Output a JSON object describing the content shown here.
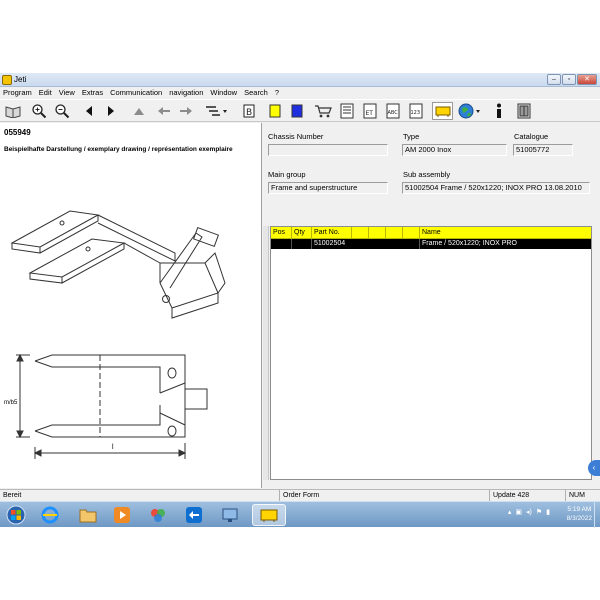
{
  "window": {
    "title": "Jeti"
  },
  "menu": [
    "Program",
    "Edit",
    "View",
    "Extras",
    "Communication",
    "navigation",
    "Window",
    "Search",
    "?"
  ],
  "left": {
    "part_number": "055949",
    "caption": "Beispielhafte Darstellung / exemplary drawing / représentation exemplaire",
    "dim_height": "m/b5",
    "dim_length": "l"
  },
  "fields": {
    "chassis_label": "Chassis Number",
    "chassis_value": "",
    "type_label": "Type",
    "type_value": "AM 2000 Inox",
    "catalogue_label": "Catalogue",
    "catalogue_value": "51005772",
    "main_group_label": "Main group",
    "main_group_value": "Frame and superstructure",
    "sub_assembly_label": "Sub assembly",
    "sub_assembly_value": "51002504  Frame / 520x1220; INOX PRO 13.08.2010"
  },
  "grid": {
    "headers": [
      "Pos",
      "Qty",
      "Part No.",
      "",
      "",
      "",
      "",
      "Name"
    ],
    "rows": [
      {
        "pos": "",
        "qty": "",
        "part_no": "51002504",
        "name": "Frame / 520x1220; INOX PRO"
      }
    ]
  },
  "status": {
    "ready": "Bereit",
    "order_form": "Order Form",
    "update": "Update 428",
    "num": "NUM"
  },
  "taskbar": {
    "time": "5:19 AM",
    "date": "8/3/2022"
  },
  "colors": {
    "grid_header": "#ffff00",
    "selected_row": "#000000",
    "taskbar": "#7fa6d0"
  }
}
